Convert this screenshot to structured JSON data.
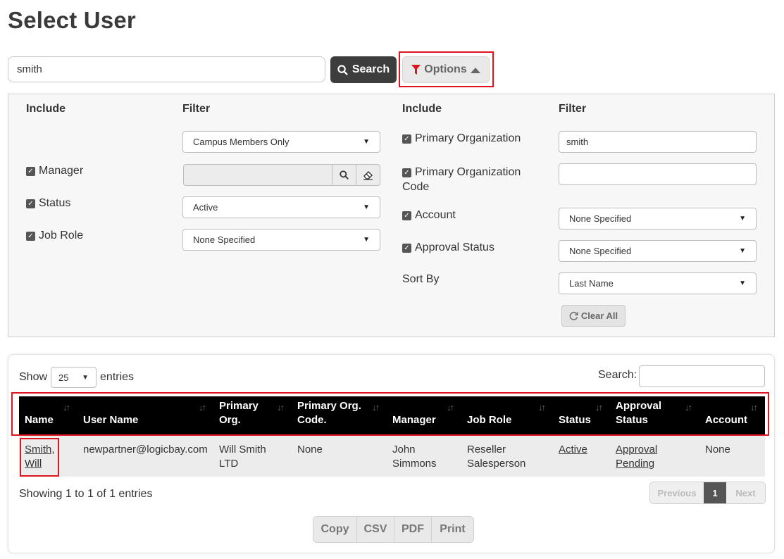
{
  "page": {
    "title": "Select User"
  },
  "search": {
    "value": "smith",
    "button_label": "Search",
    "options_label": "Options"
  },
  "filters": {
    "left_include_header": "Include",
    "left_filter_header": "Filter",
    "right_include_header": "Include",
    "right_filter_header": "Filter",
    "scope_select": "Campus Members Only",
    "manager_label": "Manager",
    "status_label": "Status",
    "status_select": "Active",
    "job_role_label": "Job Role",
    "job_role_select": "None Specified",
    "primary_org_label": "Primary Organization",
    "primary_org_value": "smith",
    "primary_org_code_label": "Primary Organization Code",
    "primary_org_code_value": "",
    "account_label": "Account",
    "account_select": "None Specified",
    "approval_status_label": "Approval Status",
    "approval_status_select": "None Specified",
    "sort_by_label": "Sort By",
    "sort_by_select": "Last Name",
    "clear_all_label": "Clear All"
  },
  "table": {
    "show_label": "Show",
    "entries_label": "entries",
    "page_length": "25",
    "search_label": "Search:",
    "columns": [
      "Name",
      "User Name",
      "Primary Org.",
      "Primary Org. Code.",
      "Manager",
      "Job Role",
      "Status",
      "Approval Status",
      "Account"
    ],
    "rows": [
      {
        "name": "Smith, Will",
        "user_name": "newpartner@logicbay.com",
        "primary_org": "Will Smith LTD",
        "primary_org_code": "None",
        "manager": "John Simmons",
        "job_role": "Reseller Salesperson",
        "status": "Active",
        "approval_status": "Approval Pending",
        "account": "None"
      }
    ],
    "info": "Showing 1 to 1 of 1 entries",
    "pager": {
      "previous": "Previous",
      "current": "1",
      "next": "Next"
    },
    "export": {
      "copy": "Copy",
      "csv": "CSV",
      "pdf": "PDF",
      "print": "Print"
    }
  },
  "colors": {
    "highlight": "#e0141e",
    "header_bg": "#000000",
    "filter_icon": "#e0141e"
  }
}
